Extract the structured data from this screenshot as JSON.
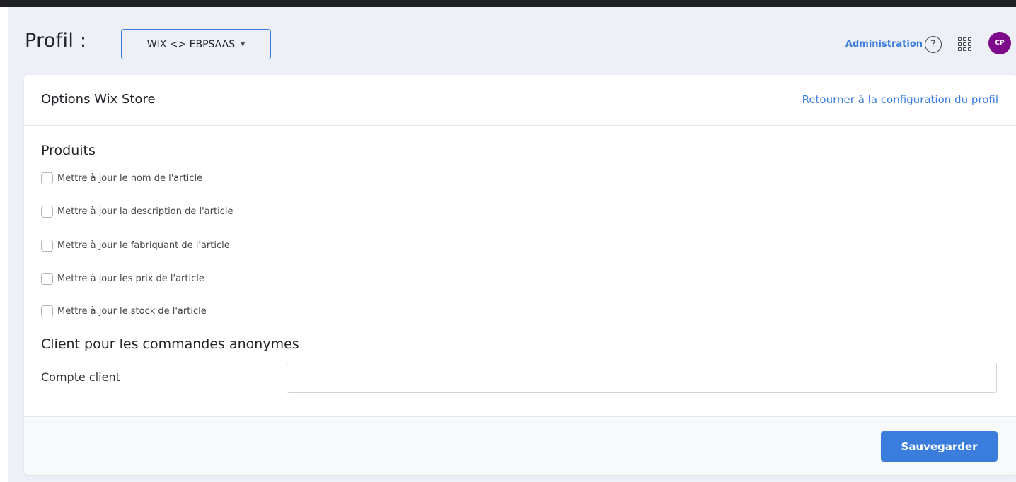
{
  "header": {
    "profile_label": "Profil :",
    "profile_selected": "WIX <> EBPSAAS",
    "admin_link": "Administration",
    "help_icon": "?",
    "avatar_initials": "CP"
  },
  "card": {
    "title": "Options Wix Store",
    "back_link": "Retourner à la configuration du profil",
    "products_section": {
      "title": "Produits",
      "options": [
        {
          "label": "Mettre à jour le nom de l'article",
          "checked": false
        },
        {
          "label": "Mettre à jour la description de l'article",
          "checked": false
        },
        {
          "label": "Mettre à jour le fabriquant de l'article",
          "checked": false
        },
        {
          "label": "Mettre à jour les prix de l'article",
          "checked": false
        },
        {
          "label": "Mettre à jour le stock de l'article",
          "checked": false
        }
      ]
    },
    "client_section": {
      "title": "Client pour les commandes anonymes",
      "field_label": "Compte client",
      "field_value": ""
    },
    "save_label": "Sauvegarder"
  },
  "colors": {
    "accent": "#3b7ddd",
    "avatar_bg": "#7c0a8a",
    "top_bar": "#1f2023",
    "page_bg": "#edf1f7"
  }
}
